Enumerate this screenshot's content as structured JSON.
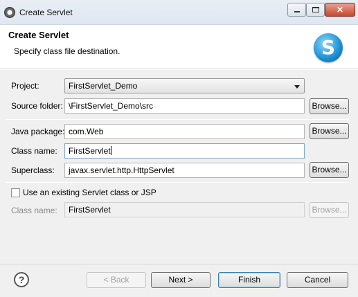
{
  "window": {
    "title": "Create Servlet",
    "controls": {
      "minimize": "",
      "maximize": "",
      "close": "✕"
    }
  },
  "banner": {
    "title": "Create Servlet",
    "subtitle": "Specify class file destination.",
    "logo_letter": "S"
  },
  "form": {
    "project": {
      "label": "Project:",
      "value": "FirstServlet_Demo"
    },
    "source_folder": {
      "label": "Source folder:",
      "value": "\\FirstServlet_Demo\\src",
      "browse": "Browse..."
    },
    "java_package": {
      "label": "Java package:",
      "value": "com.Web",
      "browse": "Browse..."
    },
    "class_name": {
      "label": "Class name:",
      "value": "FirstServlet"
    },
    "superclass": {
      "label": "Superclass:",
      "value": "javax.servlet.http.HttpServlet",
      "browse": "Browse..."
    },
    "existing": {
      "label": "Use an existing Servlet class or JSP",
      "checked": false
    },
    "existing_class": {
      "label": "Class name:",
      "value": "FirstServlet",
      "browse": "Browse..."
    }
  },
  "footer": {
    "help": "?",
    "back": "< Back",
    "next": "Next >",
    "finish": "Finish",
    "cancel": "Cancel"
  }
}
